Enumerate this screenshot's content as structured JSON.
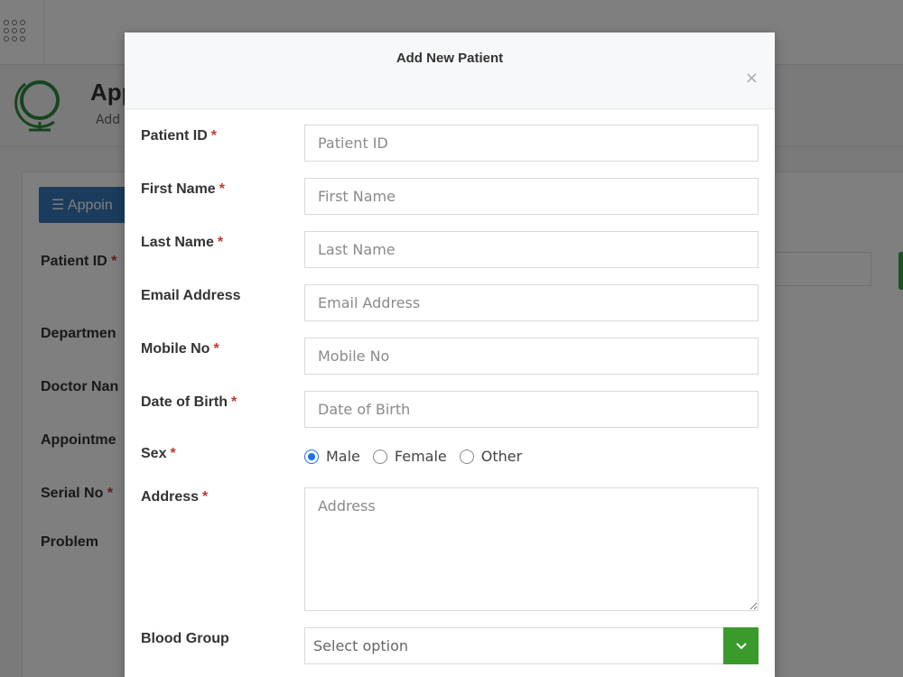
{
  "background": {
    "page_title": "App",
    "page_subtitle": "Add",
    "appointment_button": "Appoin",
    "labels": [
      {
        "text": "Patient ID",
        "required": true
      },
      {
        "text": "Departmen",
        "required": false
      },
      {
        "text": "Doctor Nan",
        "required": false
      },
      {
        "text": "Appointme",
        "required": false
      },
      {
        "text": "Serial No",
        "required": true
      },
      {
        "text": "Problem",
        "required": false
      }
    ]
  },
  "modal": {
    "title": "Add New Patient",
    "close_label": "×",
    "fields": {
      "patient_id": {
        "label": "Patient ID",
        "placeholder": "Patient ID",
        "required": "*"
      },
      "first_name": {
        "label": "First Name",
        "placeholder": "First Name",
        "required": "*"
      },
      "last_name": {
        "label": "Last Name",
        "placeholder": "Last Name",
        "required": "*"
      },
      "email": {
        "label": "Email Address",
        "placeholder": "Email Address"
      },
      "mobile": {
        "label": "Mobile No",
        "placeholder": "Mobile No",
        "required": "*"
      },
      "dob": {
        "label": "Date of Birth",
        "placeholder": "Date of Birth",
        "required": "*"
      },
      "sex": {
        "label": "Sex",
        "required": "*",
        "options": [
          "Male",
          "Female",
          "Other"
        ],
        "selected": "Male"
      },
      "address": {
        "label": "Address",
        "placeholder": "Address",
        "required": "*"
      },
      "blood_group": {
        "label": "Blood Group",
        "placeholder": "Select option"
      }
    }
  },
  "colors": {
    "primary_blue": "#3779b8",
    "success_green": "#3a9a2b",
    "required_red": "#c0392b",
    "radio_blue": "#1a73e8"
  }
}
